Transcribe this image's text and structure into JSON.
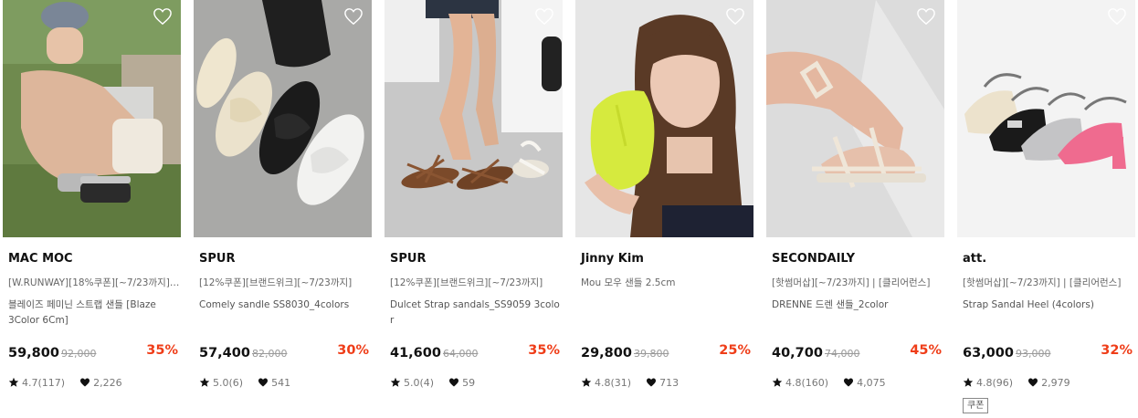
{
  "products": [
    {
      "brand": "MAC MOC",
      "promo": "[W.RUNWAY][18%쿠폰][~7/23까지] ...",
      "name": "블레이즈 페미닌 스트랩 샌들 [Blaze 3Color 6Cm]",
      "price": "59,800",
      "original_price": "92,000",
      "discount": "35%",
      "rating": "4.7(117)",
      "likes": "2,226",
      "coupon": ""
    },
    {
      "brand": "SPUR",
      "promo": "[12%쿠폰][브랜드위크][~7/23까지]",
      "name": "Comely sandle SS8030_4colors",
      "price": "57,400",
      "original_price": "82,000",
      "discount": "30%",
      "rating": "5.0(6)",
      "likes": "541",
      "coupon": ""
    },
    {
      "brand": "SPUR",
      "promo": "[12%쿠폰][브랜드위크][~7/23까지]",
      "name": "Dulcet Strap sandals_SS9059 3color",
      "price": "41,600",
      "original_price": "64,000",
      "discount": "35%",
      "rating": "5.0(4)",
      "likes": "59",
      "coupon": ""
    },
    {
      "brand": "Jinny Kim",
      "promo": "Mou 모우 샌들 2.5cm",
      "name": "",
      "price": "29,800",
      "original_price": "39,800",
      "discount": "25%",
      "rating": "4.8(31)",
      "likes": "713",
      "coupon": ""
    },
    {
      "brand": "SECONDAILY",
      "promo": "[핫썸머삽][~7/23까지] | [클리어런스]",
      "name": "DRENNE 드렌 샌들_2color",
      "price": "40,700",
      "original_price": "74,000",
      "discount": "45%",
      "rating": "4.8(160)",
      "likes": "4,075",
      "coupon": ""
    },
    {
      "brand": "att.",
      "promo": "[핫썸머삽][~7/23까지] | [클리어런스]",
      "name": "Strap Sandal Heel (4colors)",
      "price": "63,000",
      "original_price": "93,000",
      "discount": "32%",
      "rating": "4.8(96)",
      "likes": "2,979",
      "coupon": "쿠폰"
    }
  ],
  "icons": {
    "like": "heart-outline-icon",
    "rating": "star-icon",
    "likes": "heart-filled-icon"
  },
  "colors": {
    "discount": "#ef3d18",
    "text": "#111111",
    "muted": "#999999"
  }
}
